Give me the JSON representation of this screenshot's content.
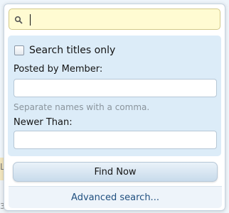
{
  "search": {
    "value": "",
    "placeholder": ""
  },
  "options": {
    "titles_only_label": "Search titles only",
    "titles_only_checked": false,
    "posted_by_label": "Posted by Member:",
    "posted_by_value": "",
    "posted_by_hint": "Separate names with a comma.",
    "newer_than_label": "Newer Than:",
    "newer_than_value": ""
  },
  "actions": {
    "find_now_label": "Find Now",
    "advanced_search_label": "Advanced search..."
  },
  "background": {
    "fragment_left_top": "Li",
    "fragment_left_bottom": "3"
  },
  "colors": {
    "search_field_bg": "#fffbd2",
    "options_panel_bg": "#dcecf8",
    "link_text": "#1f4f7f"
  }
}
